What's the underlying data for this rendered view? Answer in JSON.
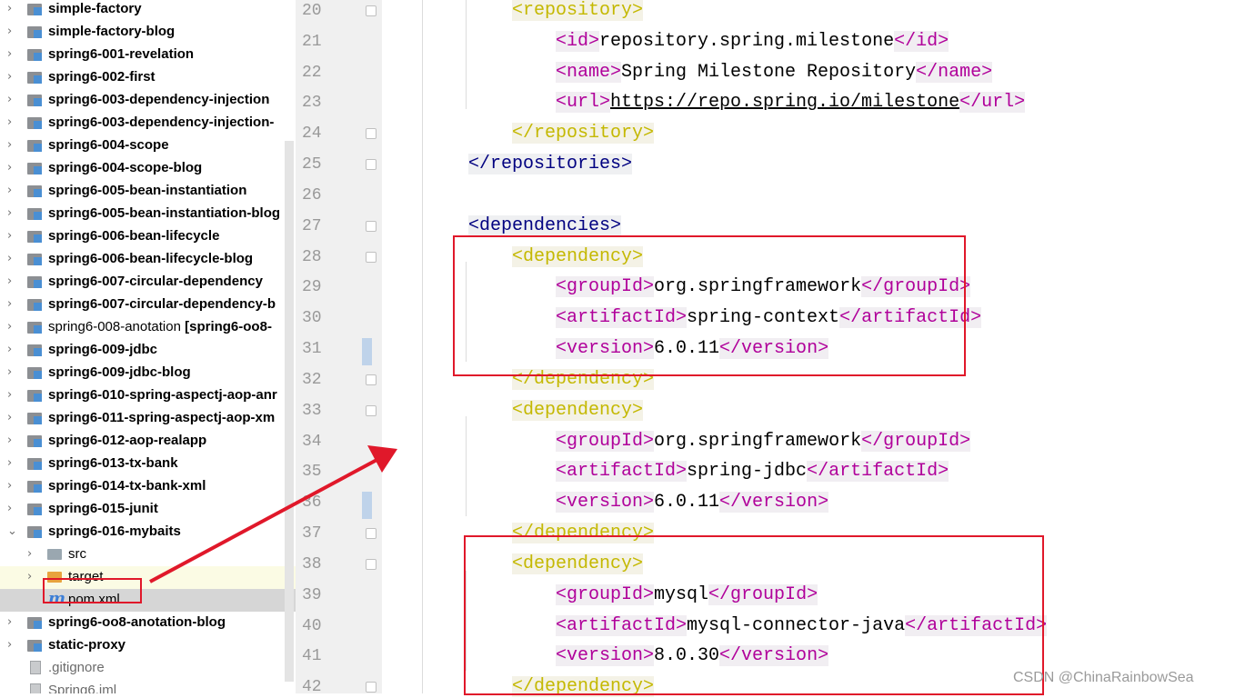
{
  "project_tree": {
    "items": [
      {
        "label": "simple-factory",
        "bold": true,
        "chev": "›",
        "icon": "module-icon"
      },
      {
        "label": "simple-factory-blog",
        "bold": true,
        "chev": "›",
        "icon": "module-icon"
      },
      {
        "label": "spring6-001-revelation",
        "bold": true,
        "chev": "›",
        "icon": "module-icon"
      },
      {
        "label": "spring6-002-first",
        "bold": true,
        "chev": "›",
        "icon": "module-icon"
      },
      {
        "label": "spring6-003-dependency-injection",
        "bold": true,
        "chev": "›",
        "icon": "module-icon"
      },
      {
        "label": "spring6-003-dependency-injection-",
        "bold": true,
        "chev": "›",
        "icon": "module-icon"
      },
      {
        "label": "spring6-004-scope",
        "bold": true,
        "chev": "›",
        "icon": "module-icon"
      },
      {
        "label": "spring6-004-scope-blog",
        "bold": true,
        "chev": "›",
        "icon": "module-icon"
      },
      {
        "label": "spring6-005-bean-instantiation",
        "bold": true,
        "chev": "›",
        "icon": "module-icon"
      },
      {
        "label": "spring6-005-bean-instantiation-blog",
        "bold": true,
        "chev": "›",
        "icon": "module-icon"
      },
      {
        "label": "spring6-006-bean-lifecycle",
        "bold": true,
        "chev": "›",
        "icon": "module-icon"
      },
      {
        "label": "spring6-006-bean-lifecycle-blog",
        "bold": true,
        "chev": "›",
        "icon": "module-icon"
      },
      {
        "label": "spring6-007-circular-dependency",
        "bold": true,
        "chev": "›",
        "icon": "module-icon"
      },
      {
        "label": "spring6-007-circular-dependency-b",
        "bold": true,
        "chev": "›",
        "icon": "module-icon"
      },
      {
        "label": "spring6-008-anotation",
        "suffix": " [spring6-oo8-",
        "bold": false,
        "chev": "›",
        "icon": "module-icon"
      },
      {
        "label": "spring6-009-jdbc",
        "bold": true,
        "chev": "›",
        "icon": "module-icon"
      },
      {
        "label": "spring6-009-jdbc-blog",
        "bold": true,
        "chev": "›",
        "icon": "module-icon"
      },
      {
        "label": "spring6-010-spring-aspectj-aop-anr",
        "bold": true,
        "chev": "›",
        "icon": "module-icon"
      },
      {
        "label": "spring6-011-spring-aspectj-aop-xm",
        "bold": true,
        "chev": "›",
        "icon": "module-icon"
      },
      {
        "label": "spring6-012-aop-realapp",
        "bold": true,
        "chev": "›",
        "icon": "module-icon"
      },
      {
        "label": "spring6-013-tx-bank",
        "bold": true,
        "chev": "›",
        "icon": "module-icon"
      },
      {
        "label": "spring6-014-tx-bank-xml",
        "bold": true,
        "chev": "›",
        "icon": "module-icon"
      },
      {
        "label": "spring6-015-junit",
        "bold": true,
        "chev": "›",
        "icon": "module-icon"
      },
      {
        "label": "spring6-016-mybaits",
        "bold": true,
        "chev": "⌄",
        "icon": "module-icon"
      },
      {
        "label": "src",
        "bold": false,
        "chev": "›",
        "icon": "folder-icon",
        "indent": 1
      },
      {
        "label": "target",
        "bold": false,
        "chev": "›",
        "icon": "folder-orange-icon",
        "indent": 1,
        "highlight": "target"
      },
      {
        "label": "pom.xml",
        "bold": false,
        "chev": "",
        "icon": "maven-icon",
        "indent": 1,
        "highlight": "selected"
      },
      {
        "label": "spring6-oo8-anotation-blog",
        "bold": true,
        "chev": "›",
        "icon": "module-icon"
      },
      {
        "label": "static-proxy",
        "bold": true,
        "chev": "›",
        "icon": "module-icon"
      },
      {
        "label": ".gitignore",
        "bold": false,
        "chev": "",
        "icon": "file-icon",
        "muted": true
      },
      {
        "label": "Spring6.iml",
        "bold": false,
        "chev": "",
        "icon": "file-icon",
        "muted": true
      }
    ]
  },
  "maven_icon_glyph": "m",
  "editor": {
    "line_numbers": [
      "20",
      "21",
      "22",
      "23",
      "24",
      "25",
      "26",
      "27",
      "28",
      "29",
      "30",
      "31",
      "32",
      "33",
      "34",
      "35",
      "36",
      "37",
      "38",
      "39",
      "40",
      "41",
      "42"
    ],
    "lines": [
      [
        {
          "t": "<repository>",
          "c": "ty"
        }
      ],
      [
        {
          "t": "<id>",
          "c": "tb"
        },
        {
          "t": "repository.spring.milestone",
          "c": ""
        },
        {
          "t": "</id>",
          "c": "tb"
        }
      ],
      [
        {
          "t": "<name>",
          "c": "tb"
        },
        {
          "t": "Spring Milestone Repository",
          "c": ""
        },
        {
          "t": "</name>",
          "c": "tb"
        }
      ],
      [
        {
          "t": "<url>",
          "c": "tb"
        },
        {
          "t": "https://repo.spring.io/milestone",
          "c": "url"
        },
        {
          "t": "</url>",
          "c": "tb"
        }
      ],
      [
        {
          "t": "</repository>",
          "c": "ty"
        }
      ],
      [
        {
          "t": "</repositories>",
          "c": "tg"
        }
      ],
      [],
      [
        {
          "t": "<dependencies>",
          "c": "tg"
        }
      ],
      [
        {
          "t": "<dependency>",
          "c": "ty"
        }
      ],
      [
        {
          "t": "<groupId>",
          "c": "tb"
        },
        {
          "t": "org.springframework",
          "c": ""
        },
        {
          "t": "</groupId>",
          "c": "tb"
        }
      ],
      [
        {
          "t": "<artifactId>",
          "c": "tb"
        },
        {
          "t": "spring-context",
          "c": ""
        },
        {
          "t": "</artifactId>",
          "c": "tb"
        }
      ],
      [
        {
          "t": "<version>",
          "c": "tb"
        },
        {
          "t": "6.0.11",
          "c": ""
        },
        {
          "t": "</version>",
          "c": "tb"
        }
      ],
      [
        {
          "t": "</dependency>",
          "c": "ty"
        }
      ],
      [
        {
          "t": "<dependency>",
          "c": "ty"
        }
      ],
      [
        {
          "t": "<groupId>",
          "c": "tb"
        },
        {
          "t": "org.springframework",
          "c": ""
        },
        {
          "t": "</groupId>",
          "c": "tb"
        }
      ],
      [
        {
          "t": "<artifactId>",
          "c": "tb"
        },
        {
          "t": "spring-jdbc",
          "c": ""
        },
        {
          "t": "</artifactId>",
          "c": "tb"
        }
      ],
      [
        {
          "t": "<version>",
          "c": "tb"
        },
        {
          "t": "6.0.11",
          "c": ""
        },
        {
          "t": "</version>",
          "c": "tb"
        }
      ],
      [
        {
          "t": "</dependency>",
          "c": "ty"
        }
      ],
      [
        {
          "t": "<dependency>",
          "c": "ty"
        }
      ],
      [
        {
          "t": "<groupId>",
          "c": "tb"
        },
        {
          "t": "mysql",
          "c": ""
        },
        {
          "t": "</groupId>",
          "c": "tb"
        }
      ],
      [
        {
          "t": "<artifactId>",
          "c": "tb"
        },
        {
          "t": "mysql-connector-java",
          "c": ""
        },
        {
          "t": "</artifactId>",
          "c": "tb"
        }
      ],
      [
        {
          "t": "<version>",
          "c": "tb"
        },
        {
          "t": "8.0.30",
          "c": ""
        },
        {
          "t": "</version>",
          "c": "tb"
        }
      ],
      [
        {
          "t": "</dependency>",
          "c": "ty"
        }
      ]
    ]
  },
  "watermark": "CSDN @ChinaRainbowSea",
  "colors": {
    "annotation_red": "#e0182a",
    "tag_navy": "#000080",
    "tag_magenta": "#b0009a",
    "tag_olive": "#c4b800"
  }
}
